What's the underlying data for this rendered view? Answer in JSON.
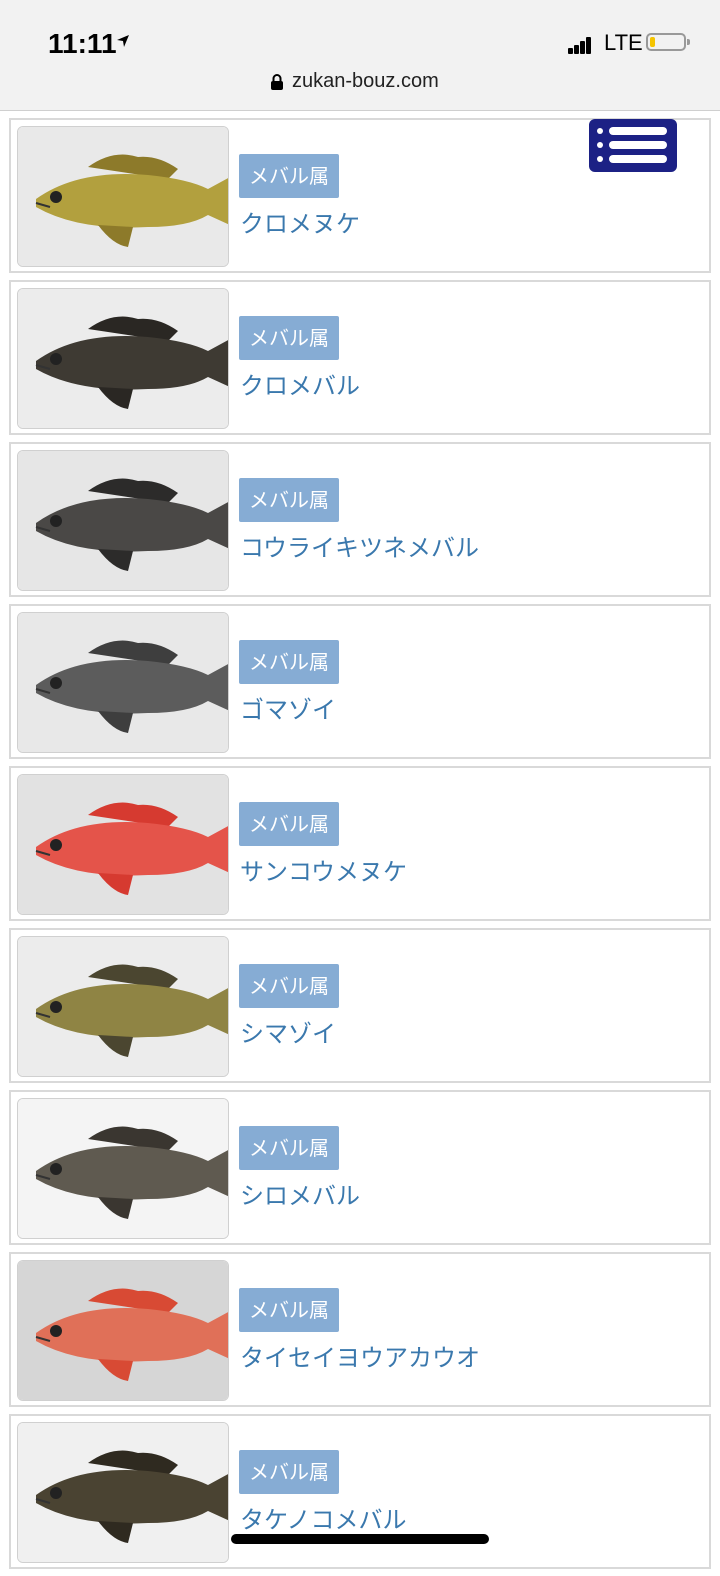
{
  "status_bar": {
    "time": "11:11",
    "carrier": "LTE",
    "location_icon": "location-arrow-icon",
    "signal_icon": "signal-bars-icon",
    "battery_icon": "battery-low-icon",
    "battery_color": "#f5c400"
  },
  "browser": {
    "url": "zukan-bouz.com",
    "lock_icon": "lock-icon"
  },
  "menu_button": {
    "icon": "list-menu-icon",
    "color": "#1c2185"
  },
  "fish_list": [
    {
      "genus": "メバル属",
      "name": "クロメヌケ",
      "body_color": "#b2a03e",
      "fin_color": "#8d7a2a",
      "bg": "#e9e9e9"
    },
    {
      "genus": "メバル属",
      "name": "クロメバル",
      "body_color": "#3e3a33",
      "fin_color": "#2a2723",
      "bg": "#ececec"
    },
    {
      "genus": "メバル属",
      "name": "コウライキツネメバル",
      "body_color": "#4a4846",
      "fin_color": "#2c2b2a",
      "bg": "#e6e6e6"
    },
    {
      "genus": "メバル属",
      "name": "ゴマゾイ",
      "body_color": "#5c5c5c",
      "fin_color": "#3e3e3e",
      "bg": "#e8e8e8"
    },
    {
      "genus": "メバル属",
      "name": "サンコウメヌケ",
      "body_color": "#e4544a",
      "fin_color": "#d63a30",
      "bg": "#e2e2e2"
    },
    {
      "genus": "メバル属",
      "name": "シマゾイ",
      "body_color": "#8f8444",
      "fin_color": "#4b4630",
      "bg": "#ececec"
    },
    {
      "genus": "メバル属",
      "name": "シロメバル",
      "body_color": "#5f5a50",
      "fin_color": "#3a3630",
      "bg": "#f4f4f4"
    },
    {
      "genus": "メバル属",
      "name": "タイセイヨウアカウオ",
      "body_color": "#e07058",
      "fin_color": "#d84a34",
      "bg": "#d6d6d6"
    },
    {
      "genus": "メバル属",
      "name": "タケノコメバル",
      "body_color": "#4a4332",
      "fin_color": "#2f2a20",
      "bg": "#f0f0f0"
    }
  ]
}
